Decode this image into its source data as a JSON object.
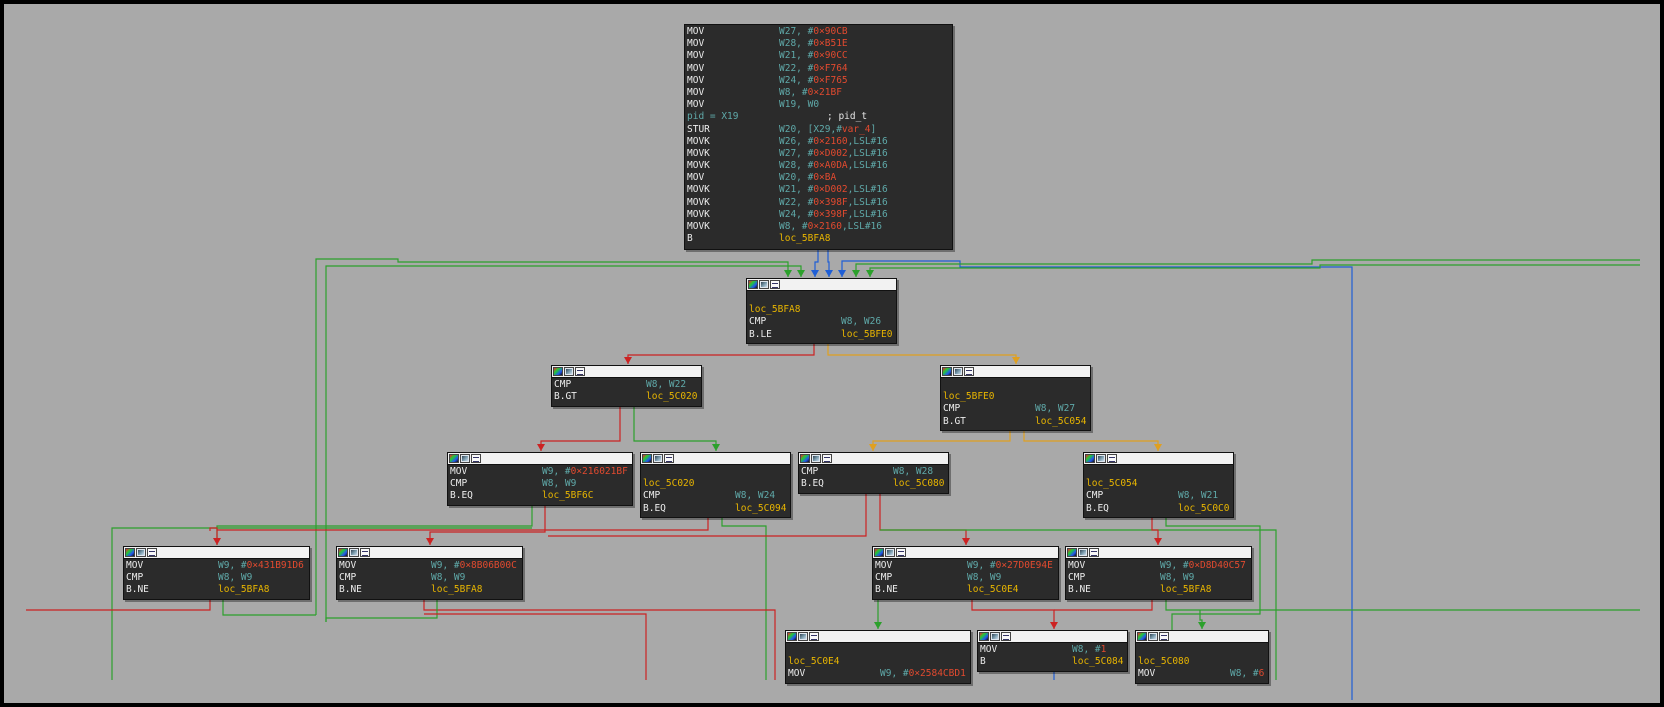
{
  "colors": {
    "background": "#a9a9a9",
    "node_bg": "#2b2b2b",
    "mnemonic": "#ededed",
    "register": "#5fa9a9",
    "number": "#e24a2f",
    "label": "#e8b500",
    "edge_true": "#2ca02c",
    "edge_false": "#cc2222",
    "edge_cond": "#e0a020",
    "edge_uncond": "#1f5fd6"
  },
  "nodes": {
    "entry": {
      "lines": [
        {
          "m": "MOV",
          "r": "W27, #",
          "n": "0×90CB",
          "s": ""
        },
        {
          "m": "MOV",
          "r": "W28, #",
          "n": "0×B51E",
          "s": ""
        },
        {
          "m": "MOV",
          "r": "W21, #",
          "n": "0×90CC",
          "s": ""
        },
        {
          "m": "MOV",
          "r": "W22, #",
          "n": "0×F764",
          "s": ""
        },
        {
          "m": "MOV",
          "r": "W24, #",
          "n": "0×F765",
          "s": ""
        },
        {
          "m": "MOV",
          "r": "W8, #",
          "n": "0×21BF",
          "s": ""
        },
        {
          "m": "MOV",
          "r": "W19, W0",
          "n": "",
          "s": ""
        },
        {
          "m": "pid = X19",
          "r": "",
          "n": "",
          "s": "; pid_t",
          "special": "pid"
        },
        {
          "m": "STUR",
          "r": "W20, [X29,#",
          "n": "var_4",
          "s": "]"
        },
        {
          "m": "MOVK",
          "r": "W26, #",
          "n": "0×2160",
          "s": ",LSL#16"
        },
        {
          "m": "MOVK",
          "r": "W27, #",
          "n": "0×D002",
          "s": ",LSL#16"
        },
        {
          "m": "MOVK",
          "r": "W28, #",
          "n": "0×A0DA",
          "s": ",LSL#16"
        },
        {
          "m": "MOV",
          "r": "W20, #",
          "n": "0×BA",
          "s": ""
        },
        {
          "m": "MOVK",
          "r": "W21, #",
          "n": "0×D002",
          "s": ",LSL#16"
        },
        {
          "m": "MOVK",
          "r": "W22, #",
          "n": "0×398F",
          "s": ",LSL#16"
        },
        {
          "m": "MOVK",
          "r": "W24, #",
          "n": "0×398F",
          "s": ",LSL#16"
        },
        {
          "m": "MOVK",
          "r": "W8, #",
          "n": "0×2160",
          "s": ",LSL#16"
        },
        {
          "m": "B",
          "r": "",
          "n": "",
          "s": "",
          "l": "loc_5BFA8"
        }
      ]
    },
    "loc_5BFA8": {
      "lines": [
        {
          "blank": true
        },
        {
          "label": "loc_5BFA8"
        },
        {
          "m": "CMP",
          "r": "W8, W26"
        },
        {
          "m": "B.LE",
          "l": "loc_5BFE0"
        }
      ]
    },
    "n_cmp_w22": {
      "lines": [
        {
          "m": "CMP",
          "r": "W8, W22"
        },
        {
          "m": "B.GT",
          "l": "loc_5C020"
        }
      ]
    },
    "loc_5BFE0": {
      "lines": [
        {
          "blank": true
        },
        {
          "label": "loc_5BFE0"
        },
        {
          "m": "CMP",
          "r": "W8, W27"
        },
        {
          "m": "B.GT",
          "l": "loc_5C054"
        }
      ]
    },
    "n_mov_216021bf": {
      "lines": [
        {
          "m": "MOV",
          "r": "W9, #",
          "n": "0×216021BF"
        },
        {
          "m": "CMP",
          "r": "W8, W9"
        },
        {
          "m": "B.EQ",
          "l": "loc_5BF6C"
        }
      ]
    },
    "loc_5C020": {
      "lines": [
        {
          "blank": true
        },
        {
          "label": "loc_5C020"
        },
        {
          "m": "CMP",
          "r": "W8, W24"
        },
        {
          "m": "B.EQ",
          "l": "loc_5C094"
        }
      ]
    },
    "n_cmp_w28": {
      "lines": [
        {
          "m": "CMP",
          "r": "W8, W28"
        },
        {
          "m": "B.EQ",
          "l": "loc_5C080"
        }
      ]
    },
    "loc_5C054": {
      "lines": [
        {
          "blank": true
        },
        {
          "label": "loc_5C054"
        },
        {
          "m": "CMP",
          "r": "W8, W21"
        },
        {
          "m": "B.EQ",
          "l": "loc_5C0C0"
        }
      ]
    },
    "n_mov_431b91d6": {
      "lines": [
        {
          "m": "MOV",
          "r": "W9, #",
          "n": "0×431B91D6"
        },
        {
          "m": "CMP",
          "r": "W8, W9"
        },
        {
          "m": "B.NE",
          "l": "loc_5BFA8"
        }
      ]
    },
    "n_mov_8b06b00c": {
      "lines": [
        {
          "m": "MOV",
          "r": "W9, #",
          "n": "0×8B06B00C"
        },
        {
          "m": "CMP",
          "r": "W8, W9"
        },
        {
          "m": "B.NE",
          "l": "loc_5BFA8"
        }
      ]
    },
    "n_mov_27d0e94e": {
      "lines": [
        {
          "m": "MOV",
          "r": "W9, #",
          "n": "0×27D0E94E"
        },
        {
          "m": "CMP",
          "r": "W8, W9"
        },
        {
          "m": "B.NE",
          "l": "loc_5C0E4"
        }
      ]
    },
    "n_mov_d8d40c57": {
      "lines": [
        {
          "m": "MOV",
          "r": "W9, #",
          "n": "0×D8D40C57"
        },
        {
          "m": "CMP",
          "r": "W8, W9"
        },
        {
          "m": "B.NE",
          "l": "loc_5BFA8"
        }
      ]
    },
    "loc_5C0E4": {
      "lines": [
        {
          "blank": true
        },
        {
          "label": "loc_5C0E4"
        },
        {
          "m": "MOV",
          "r": "W9, #",
          "n": "0×2584CBD1"
        }
      ]
    },
    "n_mov_w8_1": {
      "lines": [
        {
          "m": "MOV",
          "r": "W8, #",
          "n": "1"
        },
        {
          "m": "B",
          "l": "loc_5C084"
        }
      ]
    },
    "loc_5C080": {
      "lines": [
        {
          "blank": true
        },
        {
          "label": "loc_5C080"
        },
        {
          "m": "MOV",
          "r": "W8, #",
          "n": "6"
        }
      ]
    }
  }
}
